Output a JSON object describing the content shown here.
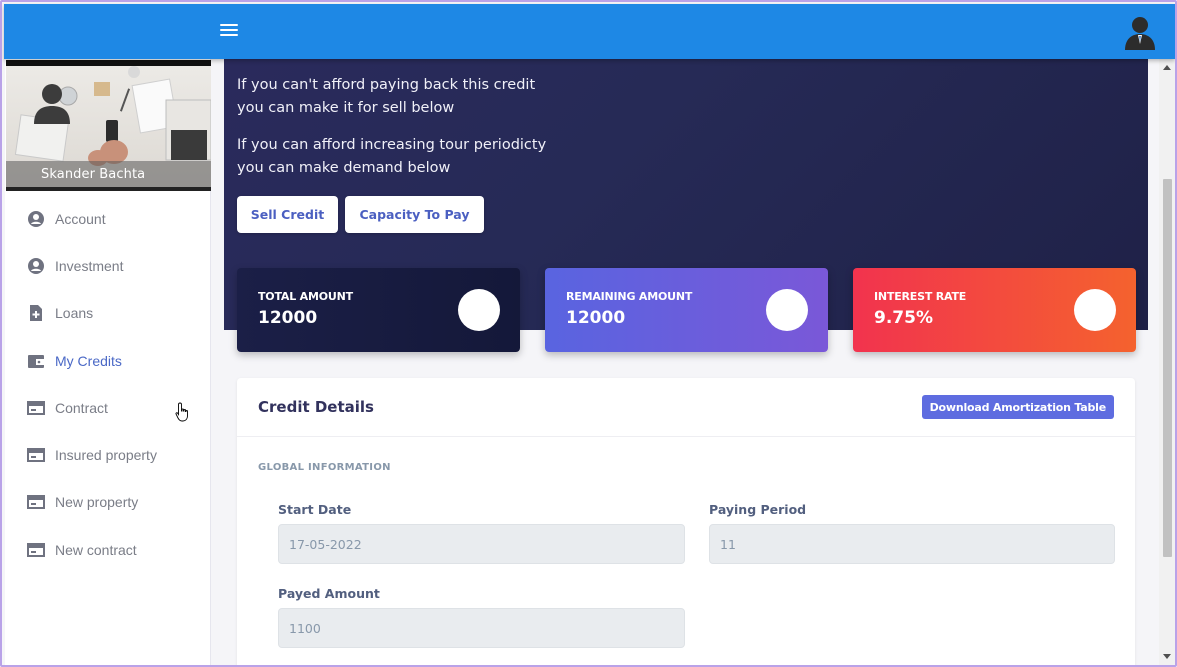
{
  "topbar": {
    "menu_icon": "hamburger-icon",
    "avatar_icon": "user-avatar-icon",
    "color": "#1e88e5"
  },
  "profile": {
    "name": "Skander Bachta"
  },
  "sidebar": {
    "items": [
      {
        "label": "Account",
        "icon": "user-circle-icon",
        "active": false
      },
      {
        "label": "Investment",
        "icon": "user-circle-icon",
        "active": false
      },
      {
        "label": "Loans",
        "icon": "file-plus-icon",
        "active": false
      },
      {
        "label": "My Credits",
        "icon": "wallet-icon",
        "active": true
      },
      {
        "label": "Contract",
        "icon": "card-icon",
        "active": false
      },
      {
        "label": "Insured property",
        "icon": "card-icon",
        "active": false
      },
      {
        "label": "New property",
        "icon": "card-icon",
        "active": false
      },
      {
        "label": "New contract",
        "icon": "card-icon",
        "active": false
      }
    ]
  },
  "hero": {
    "line1": "If you can't afford paying back this credit",
    "line2": "you can make it for sell below",
    "line3": "If you can afford increasing tour periodicty",
    "line4": "you can make demand below",
    "sell_button": "Sell Credit",
    "capacity_button": "Capacity To Pay"
  },
  "stats": {
    "total": {
      "label": "TOTAL AMOUNT",
      "value": "12000"
    },
    "remaining": {
      "label": "REMAINING AMOUNT",
      "value": "12000"
    },
    "rate": {
      "label": "INTEREST RATE",
      "value": "9.75%"
    }
  },
  "details": {
    "title": "Credit Details",
    "download_button": "Download Amortization Table",
    "section": "GLOBAL INFORMATION",
    "start_date": {
      "label": "Start Date",
      "value": "17-05-2022"
    },
    "paying_period": {
      "label": "Paying Period",
      "value": "11"
    },
    "payed_amount": {
      "label": "Payed Amount",
      "value": "1100"
    }
  }
}
